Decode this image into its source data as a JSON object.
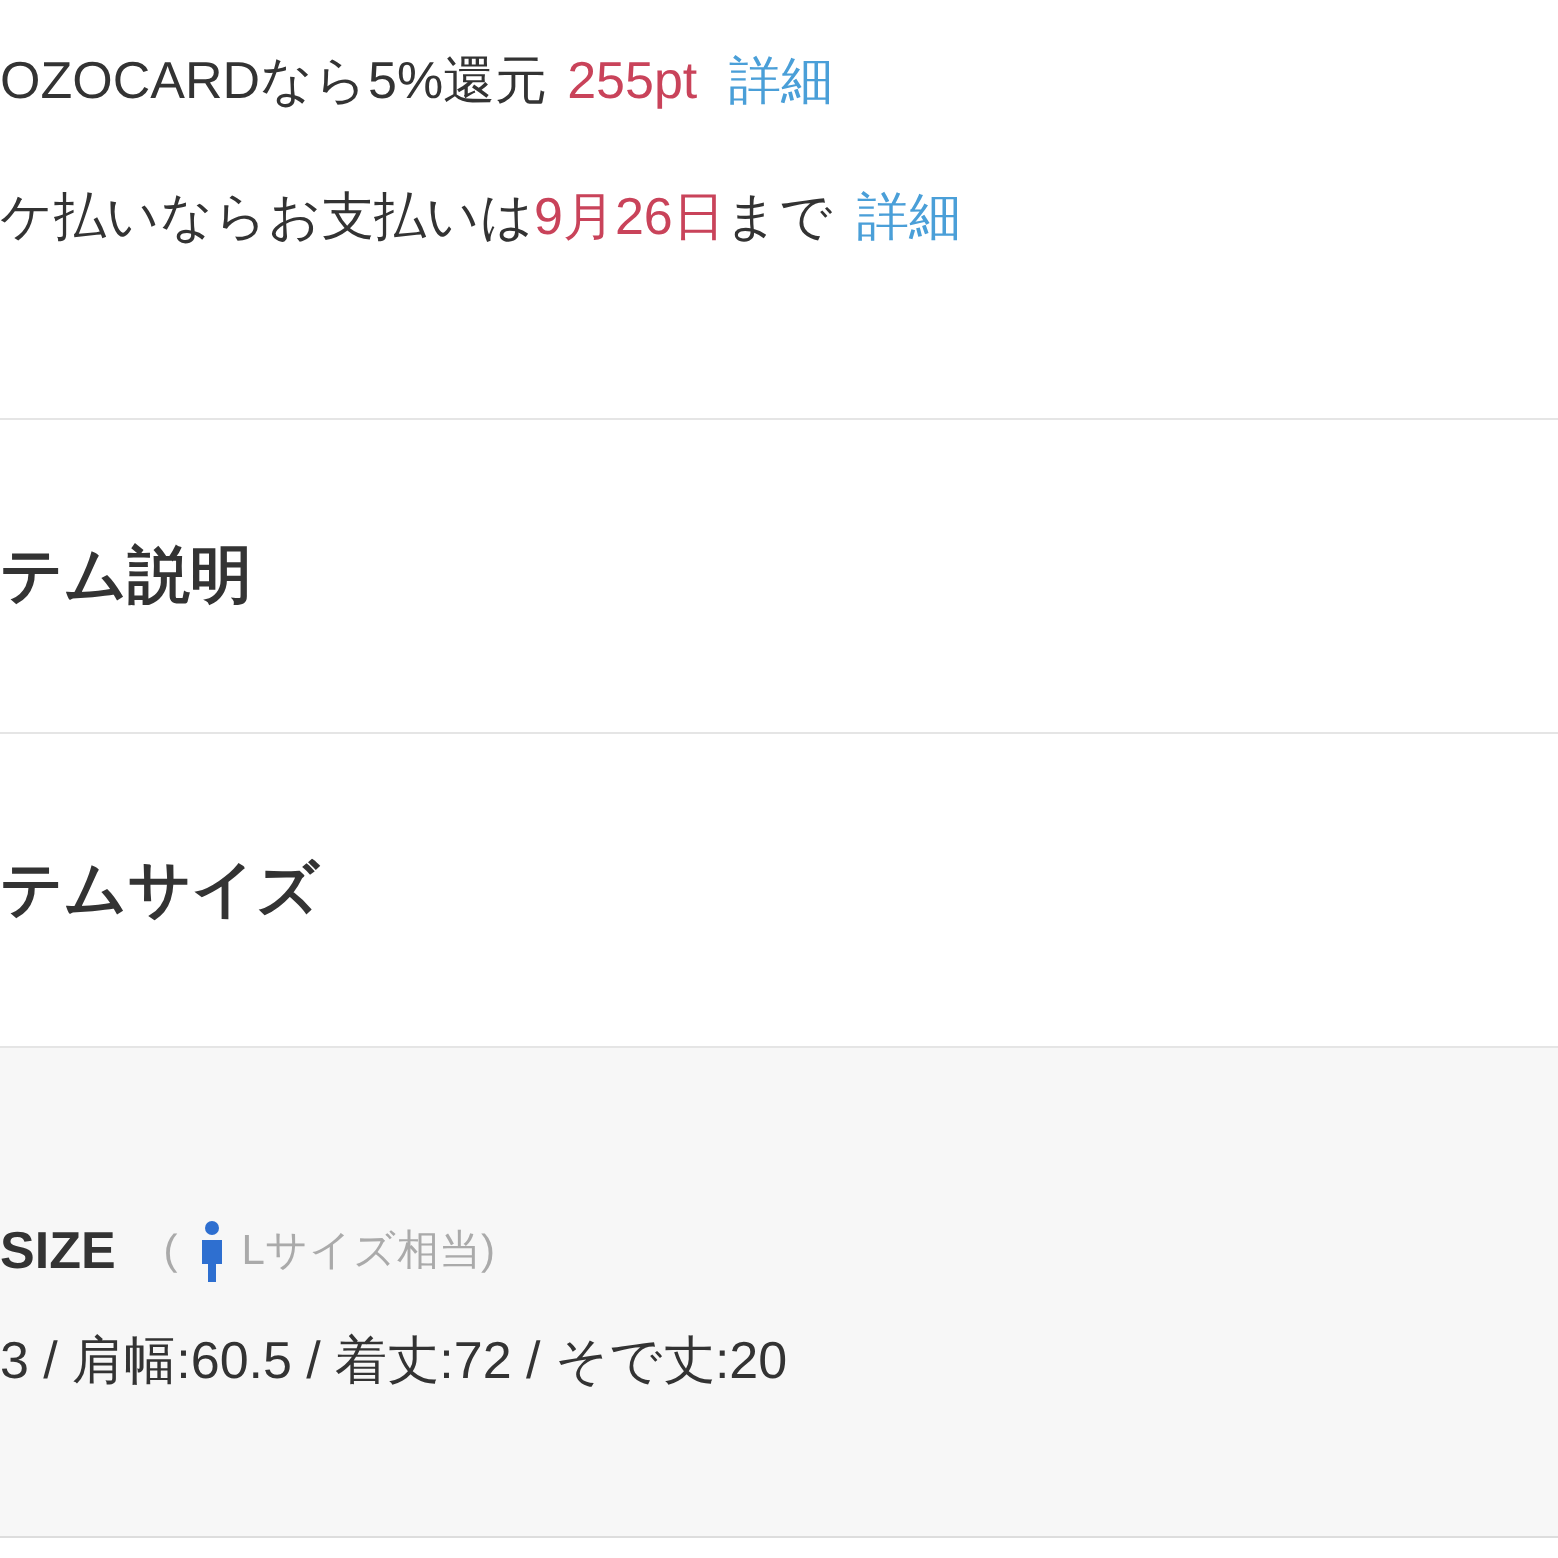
{
  "card_offer": {
    "text": "OZOCARDなら5%還元",
    "points": "255pt",
    "link": "詳細"
  },
  "deferred_payment": {
    "text": "ケ払いならお支払いは",
    "date": "9月26日",
    "suffix": "まで",
    "link": "詳細"
  },
  "sections": [
    {
      "title": "テム説明"
    },
    {
      "title": "テムサイズ"
    }
  ],
  "size_info": {
    "label": "SIZE",
    "open_paren": "(",
    "equivalent": "Lサイズ相当)",
    "measurements": "3 / 肩幅:60.5 / 着丈:72 / そで丈:20"
  }
}
